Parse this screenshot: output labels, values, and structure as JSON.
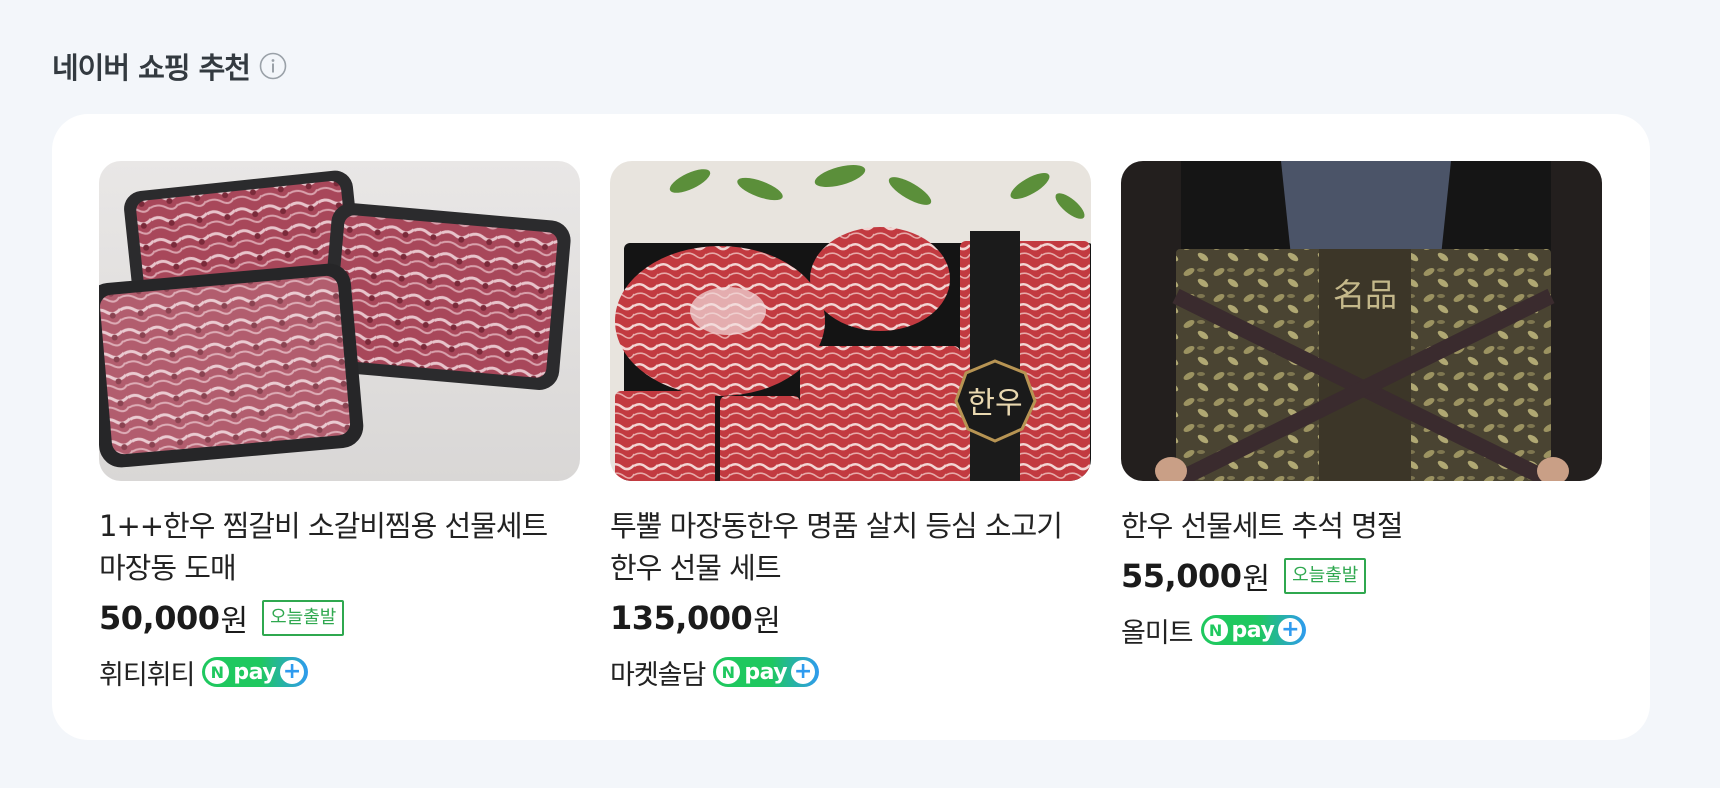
{
  "section": {
    "title": "네이버 쇼핑 추천",
    "info_icon": "info-circle-icon"
  },
  "colors": {
    "badge_green": "#2fa84f",
    "npay_green": "#1fc85f",
    "npay_blue": "#2f9bef",
    "panel_bg": "#ffffff",
    "page_bg": "#f3f6fa"
  },
  "products": [
    {
      "title_line1": "1++한우 찜갈비 소갈비찜용 선물세트",
      "title_line2": "마장동 도매",
      "price": "50,000",
      "currency": "원",
      "badge": "오늘출발",
      "seller": "휘티휘티",
      "image_icon": "beef-short-ribs-photo"
    },
    {
      "title_line1": "투뿔 마장동한우 명품 살치 등심 소고기",
      "title_line2": "한우 선물 세트",
      "price": "135,000",
      "currency": "원",
      "badge": "",
      "seller": "마켓솔담",
      "image_icon": "hanwoo-gift-box-photo"
    },
    {
      "title_line1": "한우 선물세트 추석 명절",
      "title_line2": "",
      "price": "55,000",
      "currency": "원",
      "badge": "오늘출발",
      "seller": "올미트",
      "image_icon": "gift-bag-photo"
    }
  ],
  "npay": {
    "n": "N",
    "text": "pay",
    "plus": "+"
  },
  "image_text": {
    "hanwoo": "한우",
    "myungpum": "名品"
  }
}
